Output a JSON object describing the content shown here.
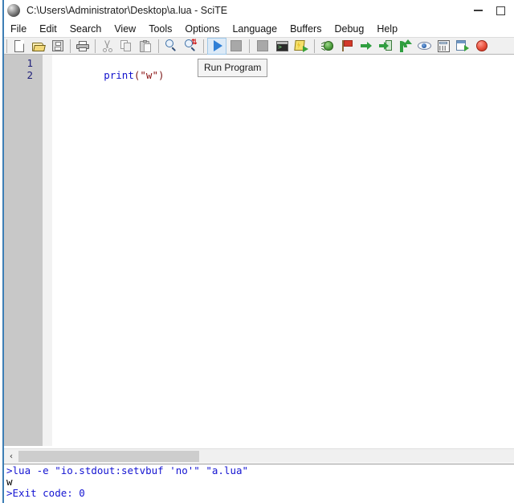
{
  "window": {
    "title": "C:\\Users\\Administrator\\Desktop\\a.lua - SciTE",
    "app_icon": "scite-globe-icon",
    "minimize_label": "Minimize",
    "maximize_label": "Maximize"
  },
  "menubar": {
    "items": [
      {
        "label": "File"
      },
      {
        "label": "Edit"
      },
      {
        "label": "Search"
      },
      {
        "label": "View"
      },
      {
        "label": "Tools"
      },
      {
        "label": "Options"
      },
      {
        "label": "Language"
      },
      {
        "label": "Buffers"
      },
      {
        "label": "Debug"
      },
      {
        "label": "Help"
      }
    ]
  },
  "toolbar": {
    "buttons": [
      {
        "name": "new-file-button",
        "icon": "new-document-icon",
        "tooltip": "New"
      },
      {
        "name": "open-file-button",
        "icon": "open-folder-icon",
        "tooltip": "Open"
      },
      {
        "name": "save-file-button",
        "icon": "floppy-save-icon",
        "tooltip": "Save"
      },
      {
        "name": "print-button",
        "icon": "printer-icon",
        "tooltip": "Print"
      },
      {
        "name": "cut-button",
        "icon": "scissors-icon",
        "tooltip": "Cut"
      },
      {
        "name": "copy-button",
        "icon": "copy-pages-icon",
        "tooltip": "Copy"
      },
      {
        "name": "paste-button",
        "icon": "clipboard-paste-icon",
        "tooltip": "Paste"
      },
      {
        "name": "find-button",
        "icon": "magnifier-icon",
        "tooltip": "Find"
      },
      {
        "name": "replace-button",
        "icon": "magnifier-replace-icon",
        "tooltip": "Replace"
      },
      {
        "name": "run-button",
        "icon": "blue-play-triangle-icon",
        "tooltip": "Run Program",
        "active": true
      },
      {
        "name": "stop-button",
        "icon": "gray-stop-square-icon",
        "tooltip": "Stop"
      },
      {
        "name": "console-button",
        "icon": "console-window-icon",
        "tooltip": "Console"
      },
      {
        "name": "build-go-button",
        "icon": "lightning-page-go-icon",
        "tooltip": "Go"
      },
      {
        "name": "debug-start-button",
        "icon": "green-bug-icon",
        "tooltip": "Start Debug"
      },
      {
        "name": "toggle-breakpoint-button",
        "icon": "red-flag-icon",
        "tooltip": "Toggle Breakpoint"
      },
      {
        "name": "step-over-button",
        "icon": "green-arrow-right-icon",
        "tooltip": "Step Over"
      },
      {
        "name": "step-into-button",
        "icon": "step-into-icon",
        "tooltip": "Step Into"
      },
      {
        "name": "step-out-button",
        "icon": "step-out-icon",
        "tooltip": "Step Out"
      },
      {
        "name": "watch-button",
        "icon": "eye-icon",
        "tooltip": "Watch"
      },
      {
        "name": "calculator-button",
        "icon": "calculator-icon",
        "tooltip": "Evaluate"
      },
      {
        "name": "output-window-button",
        "icon": "window-go-icon",
        "tooltip": "Output Window"
      },
      {
        "name": "stop-debug-button",
        "icon": "red-circle-stop-icon",
        "tooltip": "Stop Debugging"
      }
    ]
  },
  "tooltip": {
    "text": "Run Program"
  },
  "editor": {
    "line_numbers": [
      "1",
      "2"
    ],
    "lines": [
      {
        "tokens": [
          {
            "text": "print",
            "type": "function"
          },
          {
            "text": "(",
            "type": "punctuation"
          },
          {
            "text": "\"w\"",
            "type": "string"
          },
          {
            "text": ")",
            "type": "punctuation"
          }
        ]
      },
      {
        "tokens": []
      }
    ]
  },
  "scrollbar": {
    "left_arrow": "‹"
  },
  "output": {
    "lines": [
      {
        "text": ">lua -e \"io.stdout:setvbuf 'no'\" \"a.lua\"",
        "type": "command"
      },
      {
        "text": "w",
        "type": "text"
      },
      {
        "text": ">Exit code: 0",
        "type": "command"
      }
    ]
  },
  "colors": {
    "accent_border": "#3d7eb5",
    "gutter": "#c8c8c8",
    "keyword": "#1111cc",
    "string": "#8a1111",
    "output_command": "#1414d2",
    "run_highlight": "#dceaf7"
  }
}
